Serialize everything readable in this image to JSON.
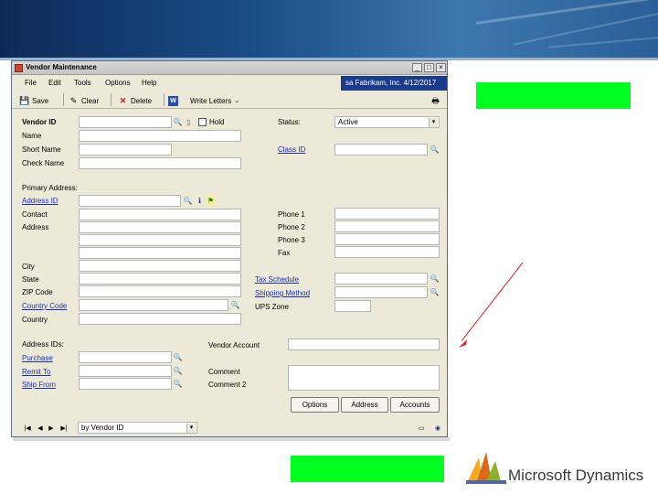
{
  "window": {
    "title": "Vendor Maintenance",
    "company": "sa  Fabrikam, Inc.  4/12/2017"
  },
  "menu": [
    "File",
    "Edit",
    "Tools",
    "Options",
    "Help"
  ],
  "toolbar": {
    "save_label": "Save",
    "clear_label": "Clear",
    "delete_label": "Delete",
    "write_letters_label": "Write Letters"
  },
  "form": {
    "vendor_id_label": "Vendor ID",
    "hold_label": "Hold",
    "status_label": "Status:",
    "status_value": "Active",
    "name_label": "Name",
    "short_name_label": "Short Name",
    "class_id_label": "Class ID",
    "check_name_label": "Check Name",
    "primary_address_label": "Primary Address:",
    "address_id_label": "Address ID",
    "contact_label": "Contact",
    "address_label": "Address",
    "phone1_label": "Phone 1",
    "phone2_label": "Phone 2",
    "phone3_label": "Phone 3",
    "fax_label": "Fax",
    "city_label": "City",
    "state_label": "State",
    "zip_label": "ZIP Code",
    "country_code_label": "Country Code",
    "country_label": "Country",
    "tax_schedule_label": "Tax Schedule",
    "shipping_method_label": "Shipping Method",
    "ups_zone_label": "UPS Zone",
    "address_ids_label": "Address IDs:",
    "purchase_label": "Purchase",
    "remit_to_label": "Remit To",
    "ship_from_label": "Ship From",
    "vendor_account_label": "Vendor Account",
    "comment1_label": "Comment",
    "comment2_label": "Comment 2"
  },
  "buttons": {
    "options_label": "Options",
    "address_label": "Address",
    "accounts_label": "Accounts"
  },
  "bottom": {
    "sort_value": "by Vendor ID"
  },
  "branding": {
    "logo_text": "Microsoft Dynamics"
  },
  "colors": {
    "highlight": "#00ff21",
    "arrow": "#e02020",
    "company_bar": "#1a3a8a"
  }
}
